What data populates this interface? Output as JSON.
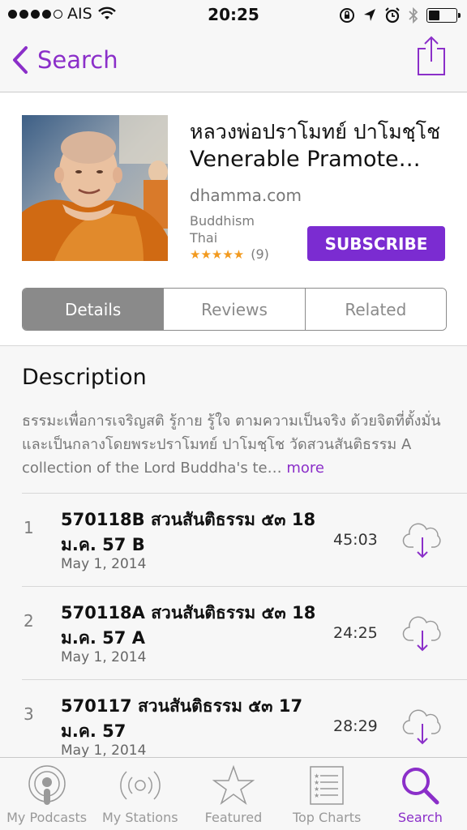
{
  "status": {
    "carrier": "AIS",
    "time": "20:25",
    "signal_bars": 4
  },
  "nav": {
    "back_label": "Search",
    "back_icon": "chevron-left-icon",
    "share_icon": "share-icon",
    "accent": "#8b2fc9"
  },
  "podcast": {
    "title_thai": "หลวงพ่อปราโมทย์ ปาโมชฺโช",
    "title_en": "Venerable Pramote…",
    "site": "dhamma.com",
    "genre": "Buddhism",
    "language": "Thai",
    "stars": "★★★★★",
    "rating_count": "(9)",
    "subscribe_label": "SUBSCRIBE"
  },
  "segments": [
    {
      "label": "Details",
      "active": true
    },
    {
      "label": "Reviews",
      "active": false
    },
    {
      "label": "Related",
      "active": false
    }
  ],
  "description": {
    "heading": "Description",
    "text": "ธรรมะเพื่อการเจริญสติ รู้กาย รู้ใจ ตามความเป็นจริง ด้วยจิตที่ตั้งมั่นและเป็นกลางโดยพระปราโมทย์ ปาโมชฺโช วัดสวนสันติธรรม A collection of the Lord Buddha's te…",
    "more_label": "more"
  },
  "episodes": [
    {
      "num": "1",
      "title_line1": "570118B สวนสันติธรรม ๕๓ 18",
      "title_line2": "ม.ค. 57 B",
      "date": "May 1, 2014",
      "duration": "45:03"
    },
    {
      "num": "2",
      "title_line1": "570118A สวนสันติธรรม ๕๓ 18",
      "title_line2": "ม.ค. 57 A",
      "date": "May 1, 2014",
      "duration": "24:25"
    },
    {
      "num": "3",
      "title_line1": "570117 สวนสันติธรรม ๕๓ 17",
      "title_line2": "ม.ค. 57",
      "date": "May 1, 2014",
      "duration": "28:29"
    }
  ],
  "tabs": [
    {
      "label": "My Podcasts",
      "icon": "podcasts-icon"
    },
    {
      "label": "My Stations",
      "icon": "stations-icon"
    },
    {
      "label": "Featured",
      "icon": "star-icon"
    },
    {
      "label": "Top Charts",
      "icon": "list-icon"
    },
    {
      "label": "Search",
      "icon": "search-icon",
      "active": true
    }
  ]
}
